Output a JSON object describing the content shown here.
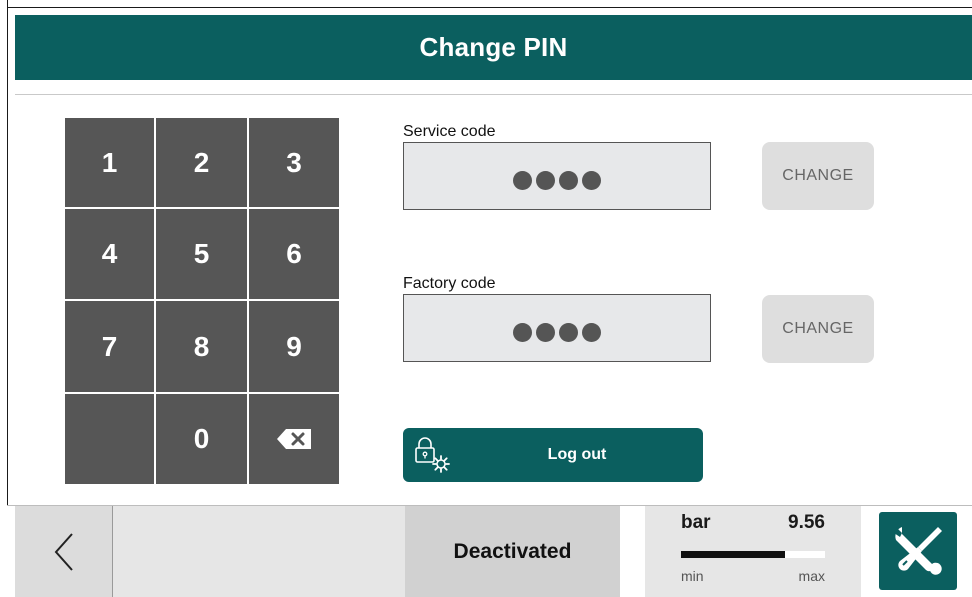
{
  "header": {
    "title": "Change PIN"
  },
  "keypad": {
    "keys": [
      "1",
      "2",
      "3",
      "4",
      "5",
      "6",
      "7",
      "8",
      "9",
      "",
      "0",
      "backspace"
    ]
  },
  "service": {
    "label": "Service code",
    "masked_digits": 4,
    "change_label": "CHANGE"
  },
  "factory": {
    "label": "Factory code",
    "masked_digits": 4,
    "change_label": "CHANGE"
  },
  "logout": {
    "label": "Log out",
    "icon": "lock-gear-icon"
  },
  "footer": {
    "back_icon": "chevron-left-icon",
    "status": "Deactivated",
    "gauge": {
      "unit": "bar",
      "value": "9.56",
      "fill_fraction": 0.72,
      "min_label": "min",
      "max_label": "max"
    },
    "tools_icon": "wrench-screwdriver-icon"
  },
  "colors": {
    "accent": "#0b5f5f",
    "key_bg": "#565656",
    "field_bg": "#e7e8ea",
    "button_disabled": "#dedede",
    "status_bg": "#d1d1d1"
  }
}
